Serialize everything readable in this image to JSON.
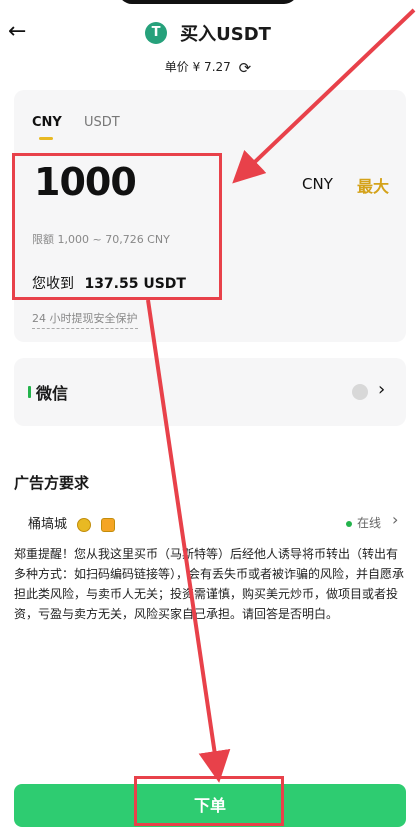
{
  "header": {
    "title": "买入USDT",
    "coin_icon": "tether-icon",
    "back_icon": "arrow-left-icon"
  },
  "price": {
    "label": "单价 ¥ 7.27",
    "refresh_icon": "refresh-icon"
  },
  "tabs": [
    {
      "label": "CNY",
      "active": true
    },
    {
      "label": "USDT",
      "active": false
    }
  ],
  "input": {
    "amount": "1000",
    "currency": "CNY",
    "max_label": "最大",
    "limit": "限额 1,000 ~ 70,726 CNY",
    "receive_label": "您收到",
    "receive_amount": "137.55 USDT",
    "safety": "24 小时提现安全保护"
  },
  "payment": {
    "method": "微信"
  },
  "ad": {
    "title": "广告方要求",
    "merchant": "桶塙城",
    "status": "在线",
    "notice": "郑重提醒！您从我这里买币（马斯特等）后经他人诱导将币转出（转出有多种方式：如扫码编码链接等），会有丢失币或者被诈骗的风险，并自愿承担此类风险，与卖币人无关；投资需谨慎，购买美元炒币，做项目或者投资，亏盈与卖方无关，风险买家自己承担。请回答是否明白。"
  },
  "footer": {
    "order_label": "下单"
  },
  "colors": {
    "accent": "#2ecc71",
    "max": "#d4a21a",
    "annotation": "#e8414a"
  }
}
